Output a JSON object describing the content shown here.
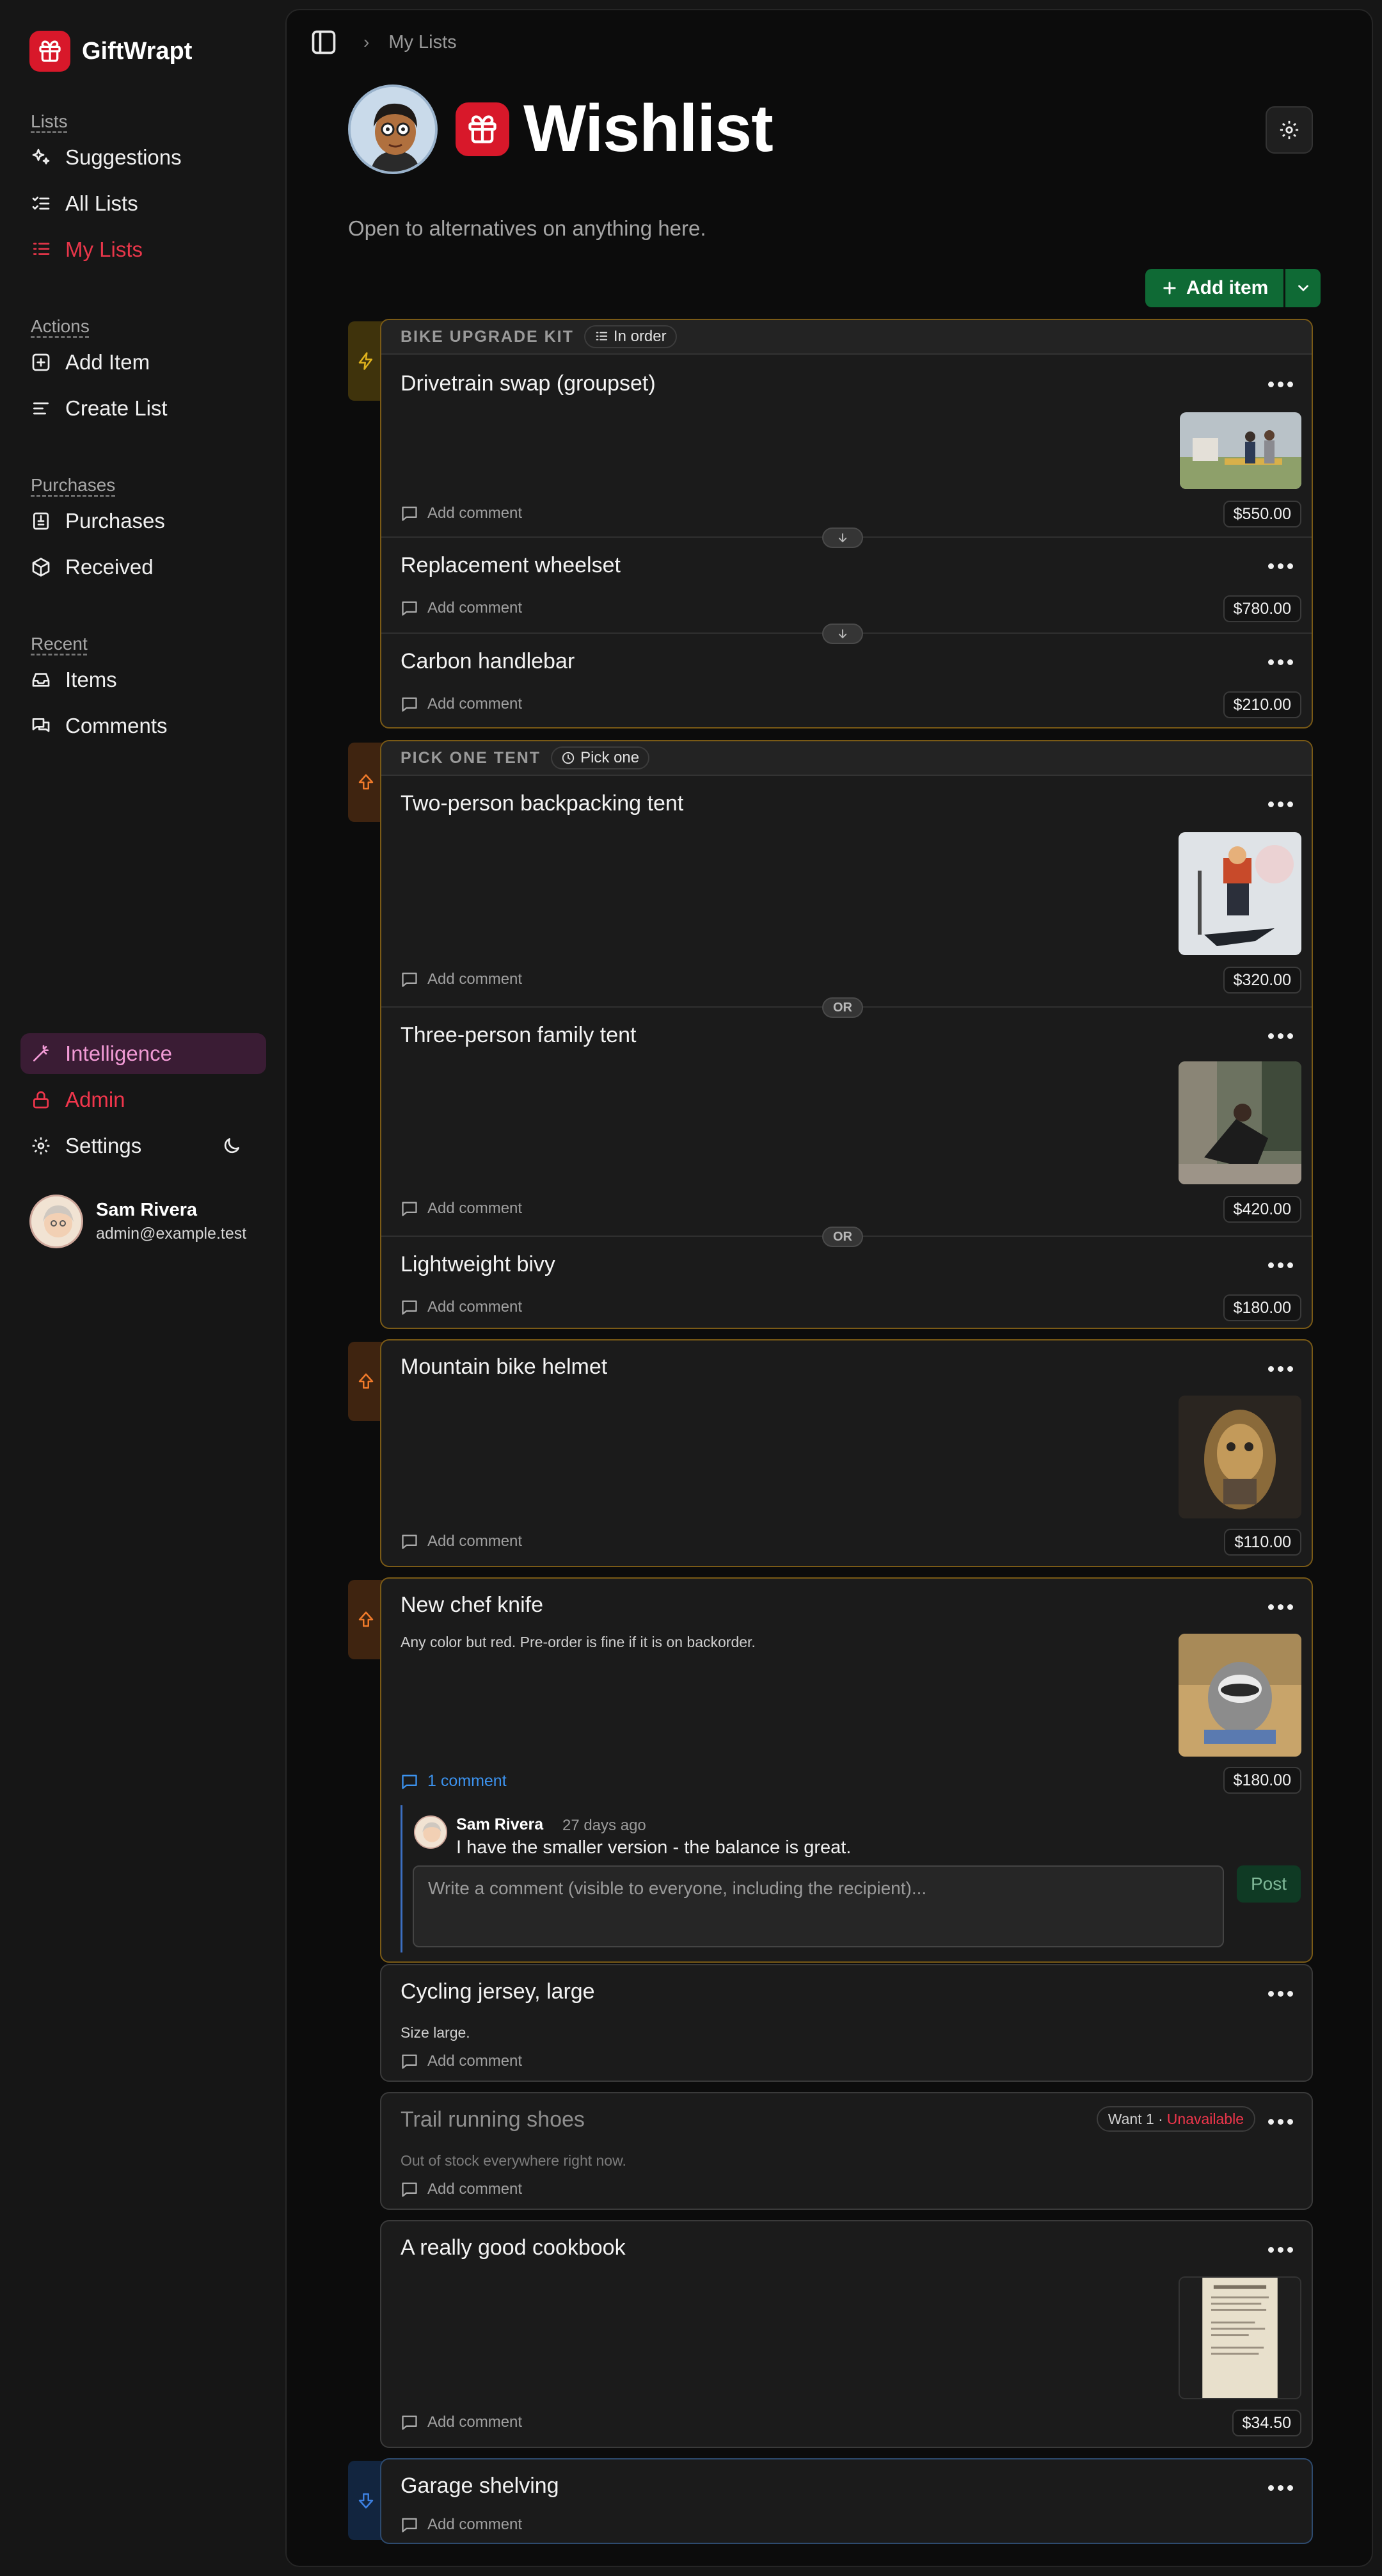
{
  "brand": {
    "name": "GiftWrapt"
  },
  "sidebar": {
    "sections": [
      {
        "heading": "Lists",
        "items": [
          "Suggestions",
          "All Lists",
          "My Lists"
        ]
      },
      {
        "heading": "Actions",
        "items": [
          "Add Item",
          "Create List"
        ]
      },
      {
        "heading": "Purchases",
        "items": [
          "Purchases",
          "Received"
        ]
      },
      {
        "heading": "Recent",
        "items": [
          "Items",
          "Comments"
        ]
      }
    ],
    "bottom": {
      "intelligence": "Intelligence",
      "admin": "Admin",
      "settings": "Settings"
    },
    "user": {
      "name": "Sam Rivera",
      "email": "admin@example.test"
    }
  },
  "header": {
    "breadcrumb": "My Lists",
    "title": "Wishlist",
    "description": "Open to alternatives on anything here.",
    "add_item_label": "Add item"
  },
  "groups": [
    {
      "name": "BIKE UPGRADE KIT",
      "badge": "In order",
      "items": [
        {
          "title": "Drivetrain swap (groupset)",
          "price": "$550.00",
          "comment_label": "Add comment"
        },
        {
          "title": "Replacement wheelset",
          "price": "$780.00",
          "comment_label": "Add comment"
        },
        {
          "title": "Carbon handlebar",
          "price": "$210.00",
          "comment_label": "Add comment"
        }
      ]
    },
    {
      "name": "PICK ONE TENT",
      "badge": "Pick one",
      "connector": "OR",
      "items": [
        {
          "title": "Two-person backpacking tent",
          "price": "$320.00",
          "comment_label": "Add comment"
        },
        {
          "title": "Three-person family tent",
          "price": "$420.00",
          "comment_label": "Add comment"
        },
        {
          "title": "Lightweight bivy",
          "price": "$180.00",
          "comment_label": "Add comment"
        }
      ]
    }
  ],
  "items": [
    {
      "title": "Mountain bike helmet",
      "price": "$110.00",
      "comment_label": "Add comment"
    },
    {
      "title": "New chef knife",
      "note": "Any color but red. Pre-order is fine if it is on backorder.",
      "price": "$180.00",
      "comments_count_label": "1 comment",
      "comment": {
        "author": "Sam Rivera",
        "time": "27 days ago",
        "text": "I have the smaller version - the balance is great."
      },
      "comment_placeholder": "Write a comment (visible to everyone, including the recipient)...",
      "post_label": "Post"
    },
    {
      "title": "Cycling jersey, large",
      "note": "Size large.",
      "comment_label": "Add comment"
    },
    {
      "title": "Trail running shoes",
      "note": "Out of stock everywhere right now.",
      "want": "Want 1 ·",
      "status": "Unavailable",
      "comment_label": "Add comment"
    },
    {
      "title": "A really good cookbook",
      "price": "$34.50",
      "comment_label": "Add comment"
    },
    {
      "title": "Garage shelving",
      "comment_label": "Add comment"
    }
  ],
  "colors": {
    "brand_red": "#d8182a",
    "add_green": "#0f6a35",
    "group_border": "#7a5a16",
    "unavailable": "#f0364c",
    "link_blue": "#3c93f0"
  },
  "icons": [
    "gift-icon",
    "sparkles-icon",
    "list-check-icon",
    "list-ordered-icon",
    "plus-square-icon",
    "list-lines-icon",
    "receipt-icon",
    "package-icon",
    "inbox-icon",
    "messages-icon",
    "wand-icon",
    "lock-icon",
    "gear-icon",
    "moon-icon",
    "sidebar-toggle-icon",
    "chevron-right-icon",
    "zap-icon",
    "arrow-up-icon",
    "arrow-down-icon",
    "comment-icon",
    "more-icon"
  ]
}
